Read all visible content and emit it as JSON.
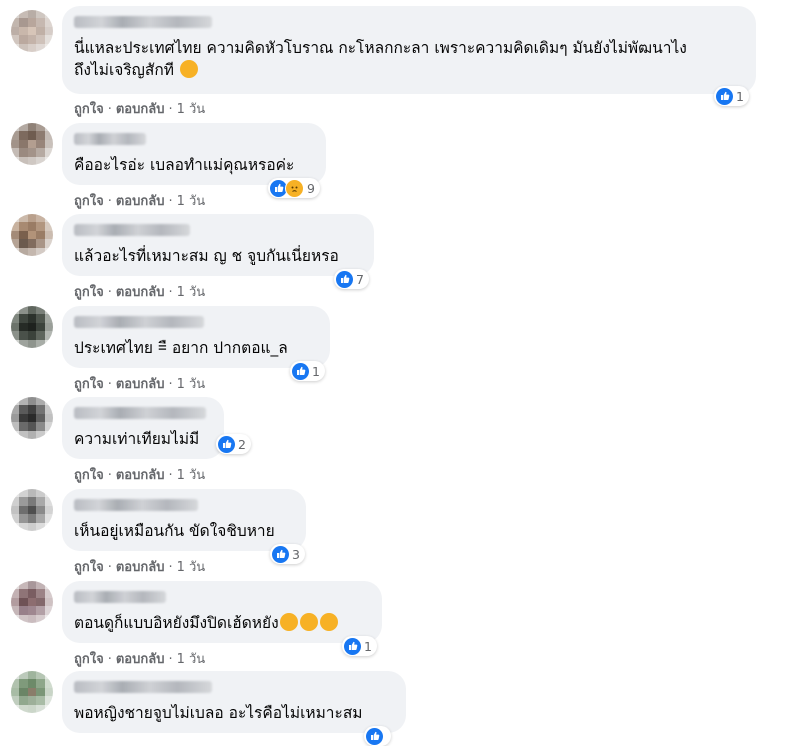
{
  "actions": {
    "like": "ถูกใจ",
    "reply": "ตอบกลับ",
    "sep": "·",
    "time": "1 วัน"
  },
  "comments": [
    {
      "text_line1": "นี่แหละประเทศไทย ความคิดหัวโบราณ กะโหลกกะลา เพราะความคิดเดิมๆ มันยังไม่พัฒนาไง",
      "text_line2": "ถึงไม่เจริญสักที",
      "emoji": "smirk-face",
      "reactions": [
        "like"
      ],
      "count": "1"
    },
    {
      "text": "คืออะไรอ่ะ เบลอทำแม่คุณหรอค่ะ",
      "reactions": [
        "like",
        "sad"
      ],
      "count": "9"
    },
    {
      "text": "แล้วอะไรที่เหมาะสม ญ ช จูบกันเนี่ยหรอ",
      "reactions": [
        "like"
      ],
      "count": "7"
    },
    {
      "text": "ประเทศไทย =ื อยาก ปากตอแ_ล",
      "reactions": [
        "like"
      ],
      "count": "1"
    },
    {
      "text": "ความเท่าเทียมไม่มี",
      "reactions": [
        "like"
      ],
      "count": "2"
    },
    {
      "text": "เห็นอยู่เหมือนกัน ขัดใจชิบหาย",
      "reactions": [
        "like"
      ],
      "count": "3"
    },
    {
      "text": "ตอนดูก็แบบอิหยังมึงปิดเฮ้ดหยัง",
      "emoji": "pouting-face",
      "reactions": [
        "like"
      ],
      "count": "1"
    },
    {
      "text": "พอหญิงชายจูบไม่เบลอ อะไรคือไม่เหมาะสม",
      "reactions": [
        "like"
      ],
      "count": ""
    }
  ],
  "colors": {
    "bubble": "#f0f2f5",
    "like": "#1877f2",
    "meta_text": "#65676b",
    "emoji": "#f7b125"
  }
}
